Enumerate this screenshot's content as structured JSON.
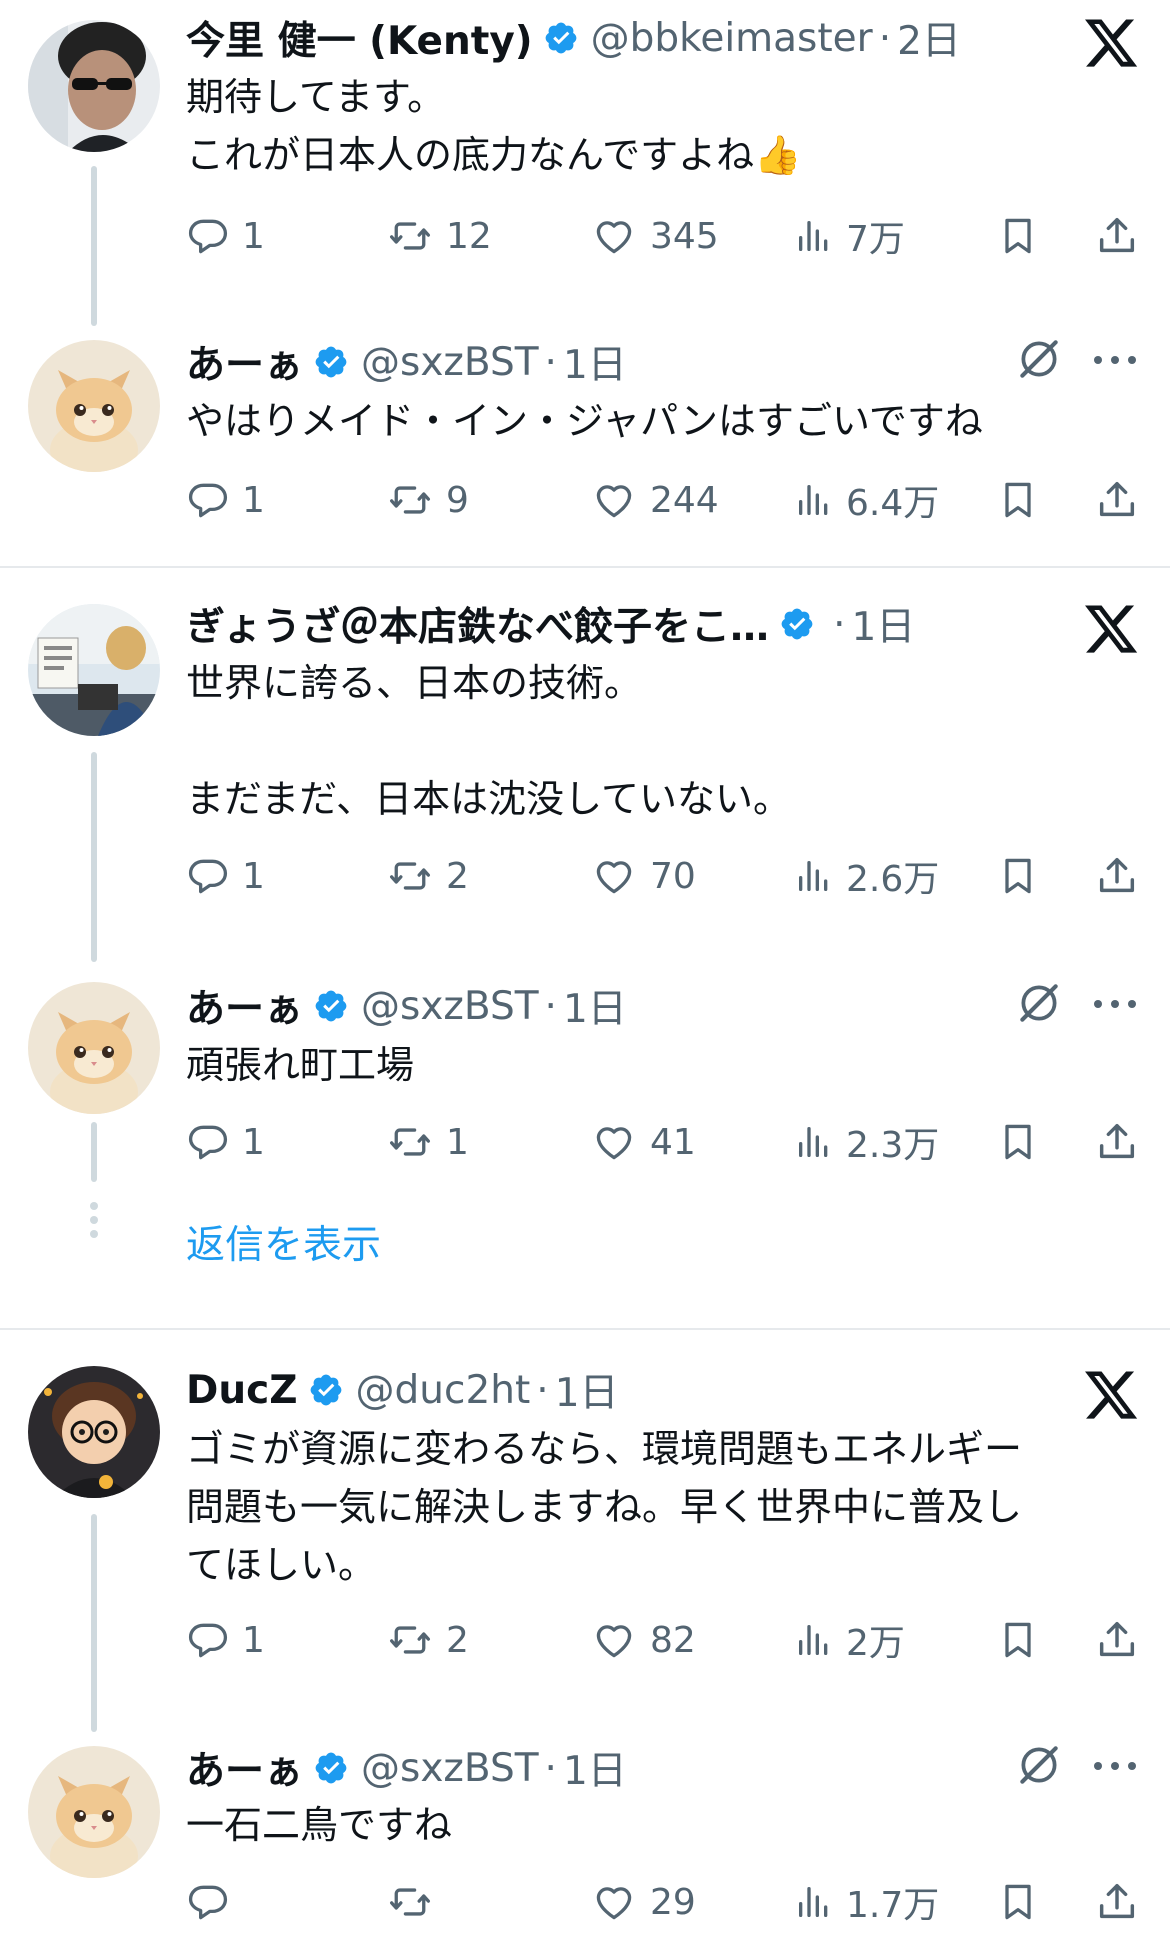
{
  "threads": [
    {
      "posts": [
        {
          "name": "今里 健一 (Kenty)",
          "handle": "@bbkeimaster",
          "time": "2日",
          "text": "期待してます。\nこれが日本人の底力なんですよね👍",
          "counts": {
            "reply": "1",
            "repost": "12",
            "like": "345",
            "views": "7万"
          },
          "badge_icon": "x-logo-icon"
        },
        {
          "name": "あーぁ",
          "handle": "@sxzBST",
          "time": "1日",
          "text": "やはりメイド・イン・ジャパンはすごいですね",
          "counts": {
            "reply": "1",
            "repost": "9",
            "like": "244",
            "views": "6.4万"
          },
          "badge_icon": "grok-icon"
        }
      ]
    },
    {
      "posts": [
        {
          "name": "ぎょうざ＠本店鉄なべ餃子をこ…",
          "handle": "",
          "time": "1日",
          "text": "世界に誇る、日本の技術。\n\nまだまだ、日本は沈没していない。",
          "counts": {
            "reply": "1",
            "repost": "2",
            "like": "70",
            "views": "2.6万"
          },
          "badge_icon": "x-logo-icon"
        },
        {
          "name": "あーぁ",
          "handle": "@sxzBST",
          "time": "1日",
          "text": "頑張れ町工場",
          "counts": {
            "reply": "1",
            "repost": "1",
            "like": "41",
            "views": "2.3万"
          },
          "badge_icon": "grok-icon"
        }
      ],
      "show_replies": "返信を表示"
    },
    {
      "posts": [
        {
          "name": "DucZ",
          "handle": "@duc2ht",
          "time": "1日",
          "text": "ゴミが資源に変わるなら、環境問題もエネルギー\n問題も一気に解決しますね。早く世界中に普及し\nてほしい。",
          "counts": {
            "reply": "1",
            "repost": "2",
            "like": "82",
            "views": "2万"
          },
          "badge_icon": "x-logo-icon"
        },
        {
          "name": "あーぁ",
          "handle": "@sxzBST",
          "time": "1日",
          "text": "一石二鳥ですね",
          "counts": {
            "reply": "",
            "repost": "",
            "like": "29",
            "views": "1.7万"
          },
          "badge_icon": "grok-icon"
        }
      ]
    }
  ],
  "separator": "·",
  "colors": {
    "text": "#0f1419",
    "secondary": "#536471",
    "accent_blue": "#1d9bf0",
    "line": "#cfd9de",
    "divider": "#e6e9ec"
  },
  "icons": [
    "reply-icon",
    "repost-icon",
    "like-icon",
    "views-icon",
    "bookmark-icon",
    "share-icon",
    "verified-badge-icon",
    "x-logo-icon",
    "grok-icon",
    "more-icon"
  ]
}
